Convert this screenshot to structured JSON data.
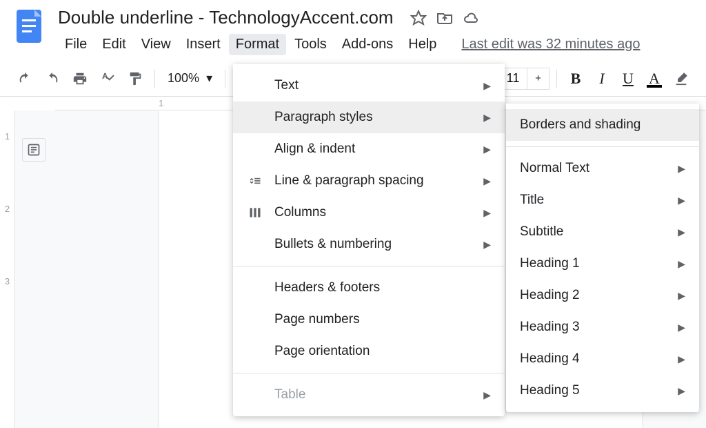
{
  "header": {
    "title": "Double underline - TechnologyAccent.com",
    "last_edit": "Last edit was 32 minutes ago"
  },
  "menubar": {
    "items": [
      "File",
      "Edit",
      "View",
      "Insert",
      "Format",
      "Tools",
      "Add-ons",
      "Help"
    ]
  },
  "toolbar": {
    "zoom": "100%",
    "font_size": "11"
  },
  "ruler_h": {
    "one": "1"
  },
  "ruler_v": {
    "one": "1",
    "two": "2",
    "three": "3"
  },
  "format_menu": {
    "text": "Text",
    "paragraph_styles": "Paragraph styles",
    "align_indent": "Align & indent",
    "line_spacing": "Line & paragraph spacing",
    "columns": "Columns",
    "bullets_numbering": "Bullets & numbering",
    "headers_footers": "Headers & footers",
    "page_numbers": "Page numbers",
    "page_orientation": "Page orientation",
    "table": "Table"
  },
  "paragraph_submenu": {
    "borders_shading": "Borders and shading",
    "normal_text": "Normal Text",
    "title": "Title",
    "subtitle": "Subtitle",
    "heading1": "Heading 1",
    "heading2": "Heading 2",
    "heading3": "Heading 3",
    "heading4": "Heading 4",
    "heading5": "Heading 5"
  }
}
